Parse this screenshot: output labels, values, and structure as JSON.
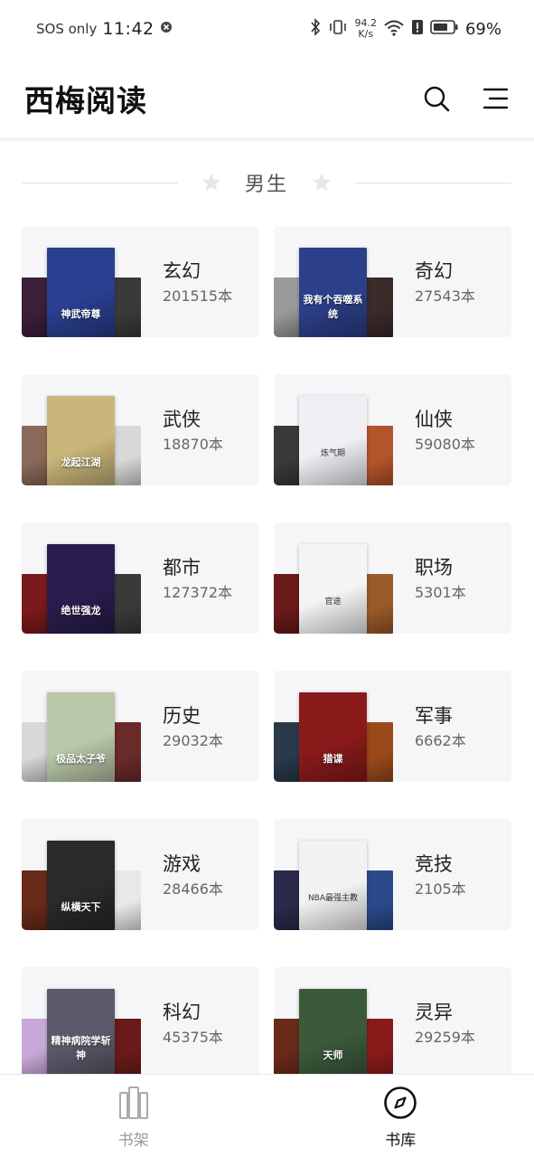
{
  "status_bar": {
    "carrier": "SOS only",
    "time": "11:42",
    "net_speed_value": "94.2",
    "net_speed_unit": "K/s",
    "battery": "69%"
  },
  "app": {
    "title": "西梅阅读"
  },
  "section": {
    "title": "男生"
  },
  "categories": [
    {
      "name": "玄幻",
      "count": "201515本",
      "cover_title": "神武帝尊",
      "colors": [
        "#3b1f3a",
        "#2a3f8f",
        "#3a3a3a"
      ]
    },
    {
      "name": "奇幻",
      "count": "27543本",
      "cover_title": "我有个吞噬系统",
      "colors": [
        "#9a9a9a",
        "#2c3f8a",
        "#3a2a2a"
      ]
    },
    {
      "name": "武侠",
      "count": "18870本",
      "cover_title": "龙起江湖",
      "colors": [
        "#8a6a5a",
        "#c9b67a",
        "#d8d8d8"
      ]
    },
    {
      "name": "仙侠",
      "count": "59080本",
      "cover_title": "炼气期",
      "colors": [
        "#3a3a3a",
        "#f0f0f4",
        "#b4542a"
      ]
    },
    {
      "name": "都市",
      "count": "127372本",
      "cover_title": "绝世强龙",
      "colors": [
        "#7a1a1a",
        "#2a1d4d",
        "#3a3a3a"
      ]
    },
    {
      "name": "职场",
      "count": "5301本",
      "cover_title": "官途",
      "colors": [
        "#6a1a1a",
        "#f4f4f4",
        "#9a5a2a"
      ]
    },
    {
      "name": "历史",
      "count": "29032本",
      "cover_title": "极品太子爷",
      "colors": [
        "#d8d8d8",
        "#b8c8a8",
        "#6a2a2a"
      ]
    },
    {
      "name": "军事",
      "count": "6662本",
      "cover_title": "猎谍",
      "colors": [
        "#2a3a4a",
        "#8a1a1a",
        "#9a4a1a"
      ]
    },
    {
      "name": "游戏",
      "count": "28466本",
      "cover_title": "纵横天下",
      "colors": [
        "#6a2a1a",
        "#2a2a2a",
        "#e8e8e8"
      ]
    },
    {
      "name": "竞技",
      "count": "2105本",
      "cover_title": "NBA最强主教",
      "colors": [
        "#2a2a4a",
        "#f2f2f2",
        "#2a4a8a"
      ]
    },
    {
      "name": "科幻",
      "count": "45375本",
      "cover_title": "精神病院学斩神",
      "colors": [
        "#c8a8d8",
        "#5a5a6a",
        "#6a1a1a"
      ]
    },
    {
      "name": "灵异",
      "count": "29259本",
      "cover_title": "天师",
      "colors": [
        "#6a2a1a",
        "#3a5a3a",
        "#8a1a1a"
      ]
    }
  ],
  "bottom_nav": {
    "shelf": "书架",
    "library": "书库"
  }
}
